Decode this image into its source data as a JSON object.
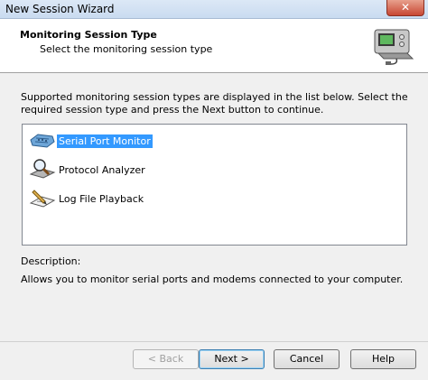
{
  "window": {
    "title": "New Session Wizard",
    "close_label": "✕"
  },
  "header": {
    "title": "Monitoring Session Type",
    "subtitle": "Select the monitoring session type",
    "icon": "monitor-device-icon"
  },
  "instructions": "Supported monitoring session types are displayed in the list below. Select the required session type and press the Next button to continue.",
  "session_types": [
    {
      "label": "Serial Port Monitor",
      "icon": "serial-port-icon",
      "selected": true
    },
    {
      "label": "Protocol Analyzer",
      "icon": "magnifier-icon",
      "selected": false
    },
    {
      "label": "Log File Playback",
      "icon": "log-playback-icon",
      "selected": false
    }
  ],
  "description": {
    "label": "Description:",
    "text": "Allows you to monitor serial ports and modems connected to your computer."
  },
  "buttons": {
    "back": "< Back",
    "next": "Next >",
    "cancel": "Cancel",
    "help": "Help"
  },
  "colors": {
    "selection": "#3399ff",
    "titlebar": "#c9dbf0",
    "close": "#c74733"
  }
}
